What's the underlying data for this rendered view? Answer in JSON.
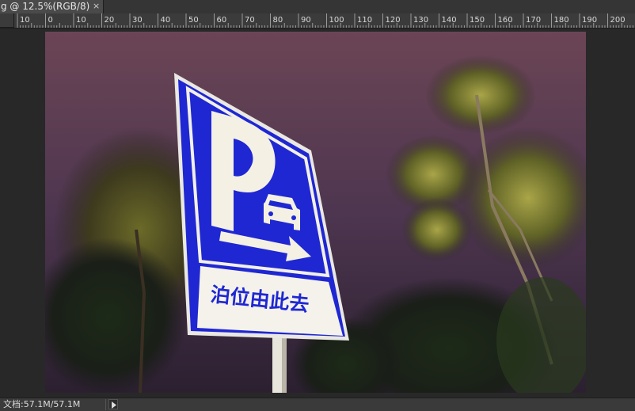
{
  "document_tab": {
    "title": "g @ 12.5%(RGB/8)",
    "close_glyph": "×"
  },
  "ruler": {
    "labels": [
      "10",
      "0",
      "10",
      "20",
      "30",
      "40",
      "50",
      "60",
      "70",
      "80",
      "90",
      "100",
      "110",
      "120",
      "130",
      "140",
      "150",
      "160",
      "170",
      "180",
      "190",
      "200"
    ]
  },
  "photo": {
    "subject": "parking-sign-photo",
    "sign_text": "泊位由此去",
    "sign_letter": "P",
    "colors": {
      "sign_blue": "#1f2ad6",
      "sign_white": "#f2f0e6",
      "sky": "#5b3d55"
    }
  },
  "status": {
    "doc_size": "文档:57.1M/57.1M"
  }
}
